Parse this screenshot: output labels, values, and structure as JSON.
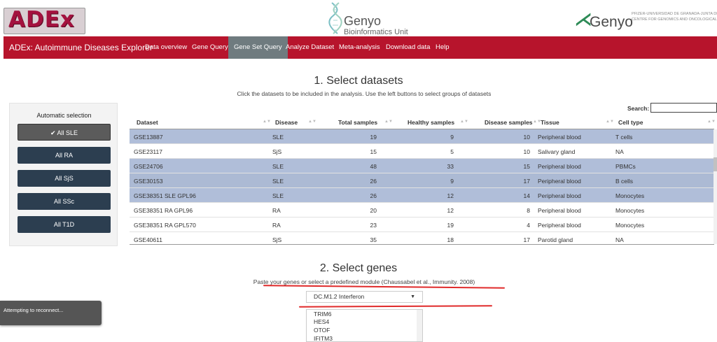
{
  "header": {
    "logo_text": "ADEx",
    "genyo_center": {
      "name": "Genyo",
      "subtitle": "Bioinformatics Unit"
    },
    "genyo_right": {
      "name": "Genyo",
      "tagline_1": "PFIZER-UNIVERSIDAD DE GRANADA-JUNTA DE ANDALUCÍA",
      "tagline_2": "CENTRE FOR GENOMICS AND ONCOLOGICAL RESEARCH"
    }
  },
  "nav": {
    "brand": "ADEx: Autoimmune Diseases Explorer",
    "items": [
      {
        "label": "Data overview",
        "active": false
      },
      {
        "label": "Gene Query",
        "active": false
      },
      {
        "label": "Gene Set Query",
        "active": true
      },
      {
        "label": "Analyze Dataset",
        "active": false
      },
      {
        "label": "Meta-analysis",
        "active": false
      },
      {
        "label": "Download data",
        "active": false
      },
      {
        "label": "Help",
        "active": false
      }
    ]
  },
  "section1": {
    "title": "1. Select datasets",
    "subtitle": "Click the datasets to be included in the analysis. Use the left buttons to select groups of datasets"
  },
  "sidebar": {
    "title": "Automatic selection",
    "buttons": [
      {
        "label": "All SLE",
        "active": true,
        "icon": "check-icon"
      },
      {
        "label": "All RA",
        "active": false
      },
      {
        "label": "All SjS",
        "active": false
      },
      {
        "label": "All SSc",
        "active": false
      },
      {
        "label": "All T1D",
        "active": false
      }
    ]
  },
  "table": {
    "search_label": "Search:",
    "search_value": "",
    "columns": [
      "Dataset",
      "Disease",
      "Total samples",
      "Healthy samples",
      "Disease samples",
      "Tissue",
      "Cell type"
    ],
    "rows": [
      {
        "selected": true,
        "cells": [
          "GSE13887",
          "SLE",
          "19",
          "9",
          "10",
          "Peripheral blood",
          "T cells"
        ]
      },
      {
        "selected": false,
        "cells": [
          "GSE23117",
          "SjS",
          "15",
          "5",
          "10",
          "Salivary gland",
          "NA"
        ]
      },
      {
        "selected": true,
        "cells": [
          "GSE24706",
          "SLE",
          "48",
          "33",
          "15",
          "Peripheral blood",
          "PBMCs"
        ]
      },
      {
        "selected": true,
        "cells": [
          "GSE30153",
          "SLE",
          "26",
          "9",
          "17",
          "Peripheral blood",
          "B cells"
        ]
      },
      {
        "selected": true,
        "cells": [
          "GSE38351 SLE GPL96",
          "SLE",
          "26",
          "12",
          "14",
          "Peripheral blood",
          "Monocytes"
        ]
      },
      {
        "selected": false,
        "cells": [
          "GSE38351 RA GPL96",
          "RA",
          "20",
          "12",
          "8",
          "Peripheral blood",
          "Monocytes"
        ]
      },
      {
        "selected": false,
        "cells": [
          "GSE38351 RA GPL570",
          "RA",
          "23",
          "19",
          "4",
          "Peripheral blood",
          "Monocytes"
        ]
      },
      {
        "selected": false,
        "cells": [
          "GSE40611",
          "SjS",
          "35",
          "18",
          "17",
          "Parotid gland",
          "NA"
        ]
      }
    ]
  },
  "section2": {
    "title": "2. Select genes",
    "subtitle": "Paste your genes or select a predefined module (Chaussabel et al., Immunity. 2008)",
    "module_selected": "DC.M1.2 Interferon",
    "genes": [
      "TRIM6",
      "HES4",
      "OTOF",
      "IFITM3"
    ]
  },
  "notification": {
    "text": "Attempting to reconnect..."
  },
  "colors": {
    "nav_bg": "#b7142c",
    "nav_active": "#6f7b7f",
    "button_dark": "#2c3e50",
    "row_selected": "#b0bed9",
    "annotation_red": "#e02a2a"
  }
}
